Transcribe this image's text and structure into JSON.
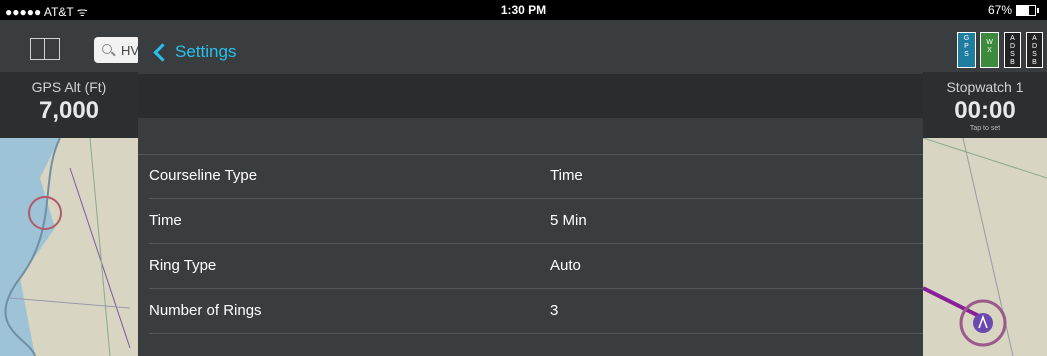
{
  "status_bar": {
    "carrier": "●●●●● AT&T ᯤ",
    "time": "1:30 PM",
    "battery": "67%"
  },
  "search": {
    "text": "HV"
  },
  "indicators": {
    "gps": "G\nP\nS",
    "wx": "W\nX",
    "adsb1": "A\nD\nS\nB",
    "adsb2": "A\nD\nS\nB"
  },
  "instrument_left": {
    "label": "GPS Alt (Ft)",
    "value": "7,000"
  },
  "instrument_right": {
    "label": "Stopwatch 1",
    "value": "00:00",
    "hint": "Tap to set"
  },
  "settings_panel": {
    "back_label": "Settings",
    "rows": [
      {
        "label": "Courseline Type",
        "value": "Time"
      },
      {
        "label": "Time",
        "value": "5 Min"
      },
      {
        "label": "Ring Type",
        "value": "Auto"
      },
      {
        "label": "Number of Rings",
        "value": "3"
      }
    ]
  },
  "colors": {
    "accent": "#29c0ec",
    "panel": "#3a3d40",
    "header": "#2a2c2e"
  },
  "icons": [
    "panels-icon",
    "search-icon",
    "chevron-left-icon",
    "battery-icon",
    "wifi-icon"
  ]
}
